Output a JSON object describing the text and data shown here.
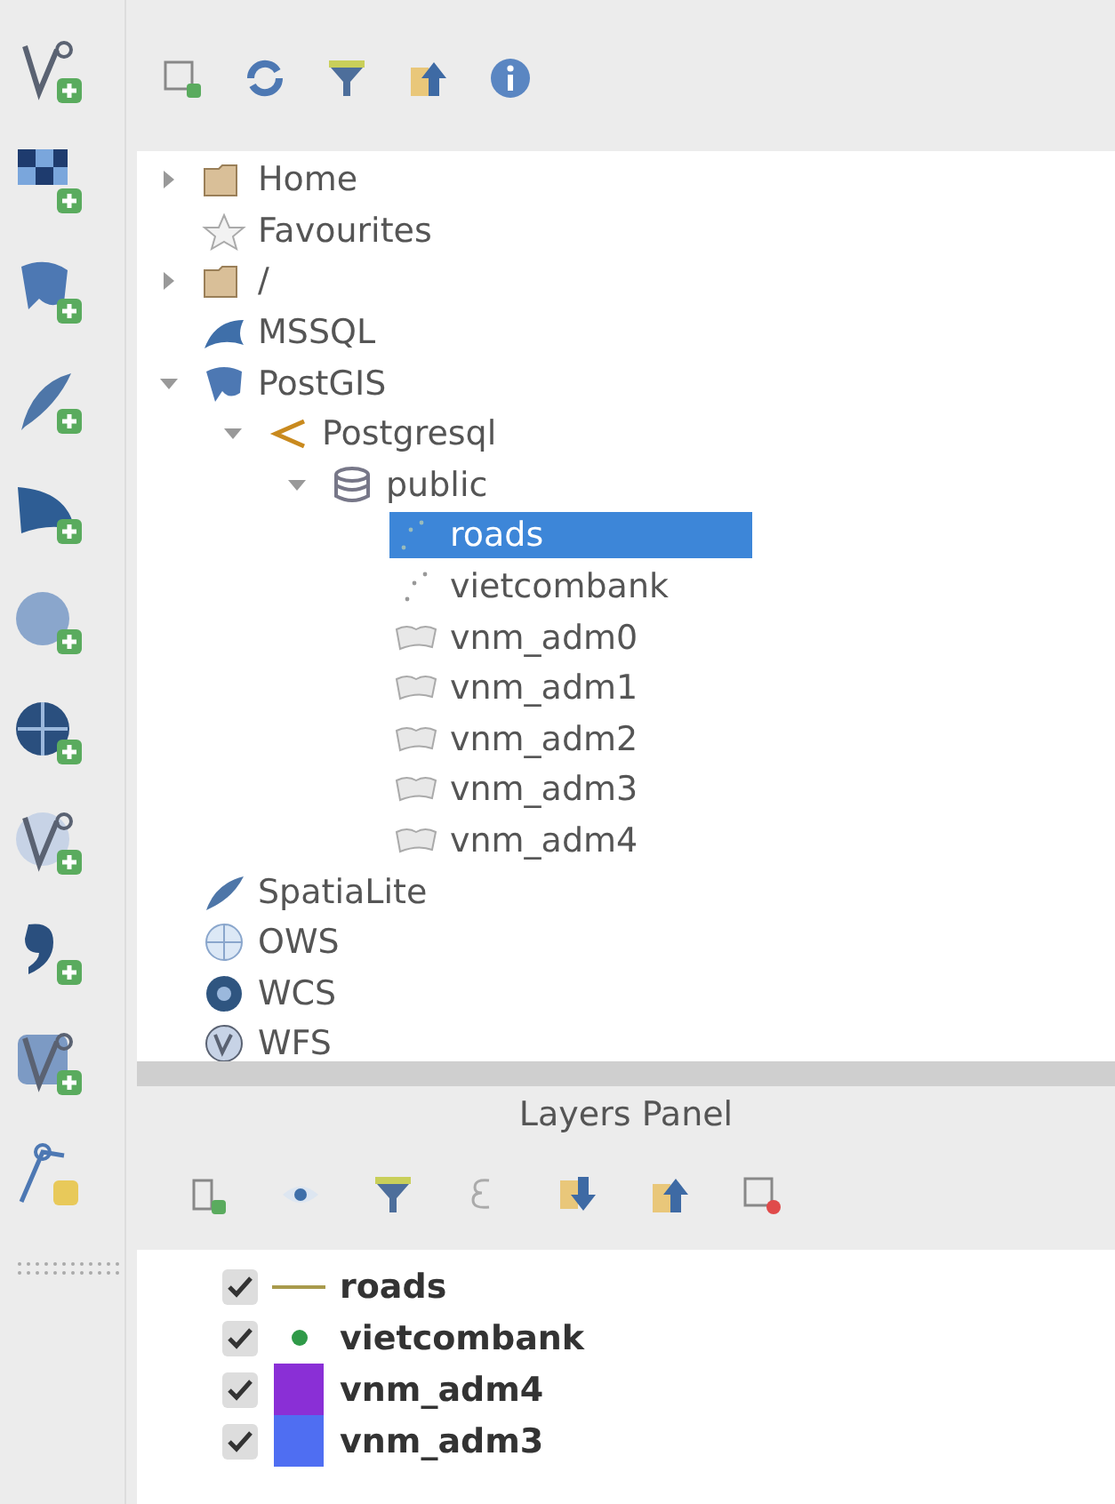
{
  "browser_panel": {
    "tree": [
      {
        "label": "Home",
        "kind": "folder",
        "expanded": false,
        "selected": false
      },
      {
        "label": "Favourites",
        "kind": "favourites",
        "selected": false
      },
      {
        "label": "/",
        "kind": "folder",
        "expanded": false,
        "selected": false
      },
      {
        "label": "MSSQL",
        "kind": "mssql",
        "selected": false
      },
      {
        "label": "PostGIS",
        "kind": "postgis",
        "expanded": true,
        "selected": false,
        "children": [
          {
            "label": "Postgresql",
            "kind": "connection",
            "expanded": true,
            "selected": false,
            "children": [
              {
                "label": "public",
                "kind": "schema",
                "expanded": true,
                "selected": false,
                "children": [
                  {
                    "label": "roads",
                    "kind": "line-layer",
                    "selected": true
                  },
                  {
                    "label": "vietcombank",
                    "kind": "point-layer",
                    "selected": false
                  },
                  {
                    "label": "vnm_adm0",
                    "kind": "polygon-layer",
                    "selected": false
                  },
                  {
                    "label": "vnm_adm1",
                    "kind": "polygon-layer",
                    "selected": false
                  },
                  {
                    "label": "vnm_adm2",
                    "kind": "polygon-layer",
                    "selected": false
                  },
                  {
                    "label": "vnm_adm3",
                    "kind": "polygon-layer",
                    "selected": false
                  },
                  {
                    "label": "vnm_adm4",
                    "kind": "polygon-layer",
                    "selected": false
                  }
                ]
              }
            ]
          }
        ]
      },
      {
        "label": "SpatiaLite",
        "kind": "spatialite",
        "selected": false
      },
      {
        "label": "OWS",
        "kind": "ows",
        "selected": false
      },
      {
        "label": "WCS",
        "kind": "wcs",
        "selected": false
      },
      {
        "label": "WFS",
        "kind": "wfs",
        "selected": false
      }
    ]
  },
  "layers_panel": {
    "title": "Layers Panel",
    "layers": [
      {
        "name": "roads",
        "checked": true,
        "kind": "line",
        "color": "#a89a4c"
      },
      {
        "name": "vietcombank",
        "checked": true,
        "kind": "point",
        "color": "#2f9a48"
      },
      {
        "name": "vnm_adm4",
        "checked": true,
        "kind": "fill",
        "color": "#8a2fd6"
      },
      {
        "name": "vnm_adm3",
        "checked": true,
        "kind": "fill",
        "color": "#4f6ef2"
      }
    ]
  }
}
